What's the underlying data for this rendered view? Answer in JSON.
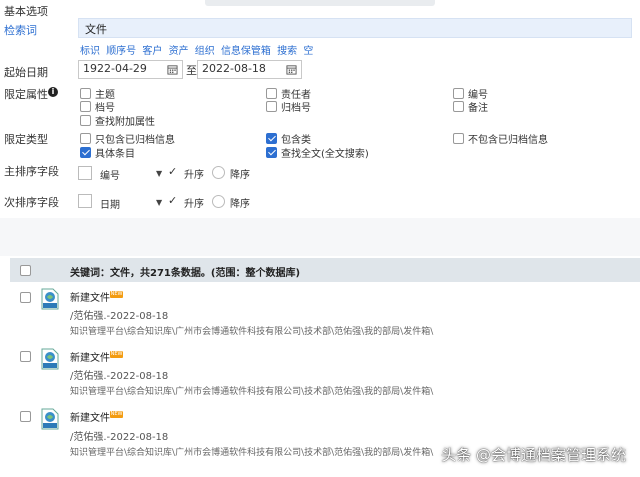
{
  "section_title": "基本选项",
  "keyword": {
    "label": "检索词",
    "value": "文件",
    "links": [
      "标识",
      "顺序号",
      "客户",
      "资产",
      "组织",
      "信息保管箱",
      "搜索",
      "空"
    ]
  },
  "date": {
    "label": "起始日期",
    "start": "1922-04-29",
    "separator": "至",
    "end": "2022-08-18"
  },
  "attributes": {
    "label": "限定属性",
    "options": [
      {
        "label": "主题",
        "checked": false
      },
      {
        "label": "责任者",
        "checked": false
      },
      {
        "label": "编号",
        "checked": false
      },
      {
        "label": "档号",
        "checked": false
      },
      {
        "label": "归档号",
        "checked": false
      },
      {
        "label": "备注",
        "checked": false
      },
      {
        "label": "查找附加属性",
        "checked": false
      }
    ]
  },
  "types": {
    "label": "限定类型",
    "options": [
      {
        "label": "只包含已归档信息",
        "checked": false
      },
      {
        "label": "包含类",
        "checked": true
      },
      {
        "label": "不包含已归档信息",
        "checked": false
      },
      {
        "label": "具体条目",
        "checked": true
      },
      {
        "label": "查找全文(全文搜索)",
        "checked": true
      }
    ]
  },
  "primary_sort": {
    "label": "主排序字段",
    "field": "编号",
    "asc": "升序",
    "desc": "降序"
  },
  "secondary_sort": {
    "label": "次排序字段",
    "field": "日期",
    "asc": "升序",
    "desc": "降序"
  },
  "results": {
    "summary": "关键词：文件，共271条数据。(范围：整个数据库)",
    "items": [
      {
        "title": "新建文件",
        "badge": "NEW",
        "meta": "/范佑强.-2022-08-18",
        "path": "知识管理平台\\综合知识库\\广州市会博通软件科技有限公司\\技术部\\范佑强\\我的部局\\发件箱\\"
      },
      {
        "title": "新建文件",
        "badge": "NEW",
        "meta": "/范佑强.-2022-08-18",
        "path": "知识管理平台\\综合知识库\\广州市会博通软件科技有限公司\\技术部\\范佑强\\我的部局\\发件箱\\"
      },
      {
        "title": "新建文件",
        "badge": "NEW",
        "meta": "/范佑强.-2022-08-18",
        "path": "知识管理平台\\综合知识库\\广州市会博通软件科技有限公司\\技术部\\范佑强\\我的部局\\发件箱\\"
      }
    ]
  },
  "watermark": "头条 @会博通档案管理系统",
  "colors": {
    "accent": "#2d6fd1",
    "header_band": "#dfe5ea",
    "badge": "#f39c12"
  },
  "icons": [
    "calendar-icon",
    "info-icon",
    "document-icon",
    "checkmark-icon",
    "caret-down-icon"
  ]
}
